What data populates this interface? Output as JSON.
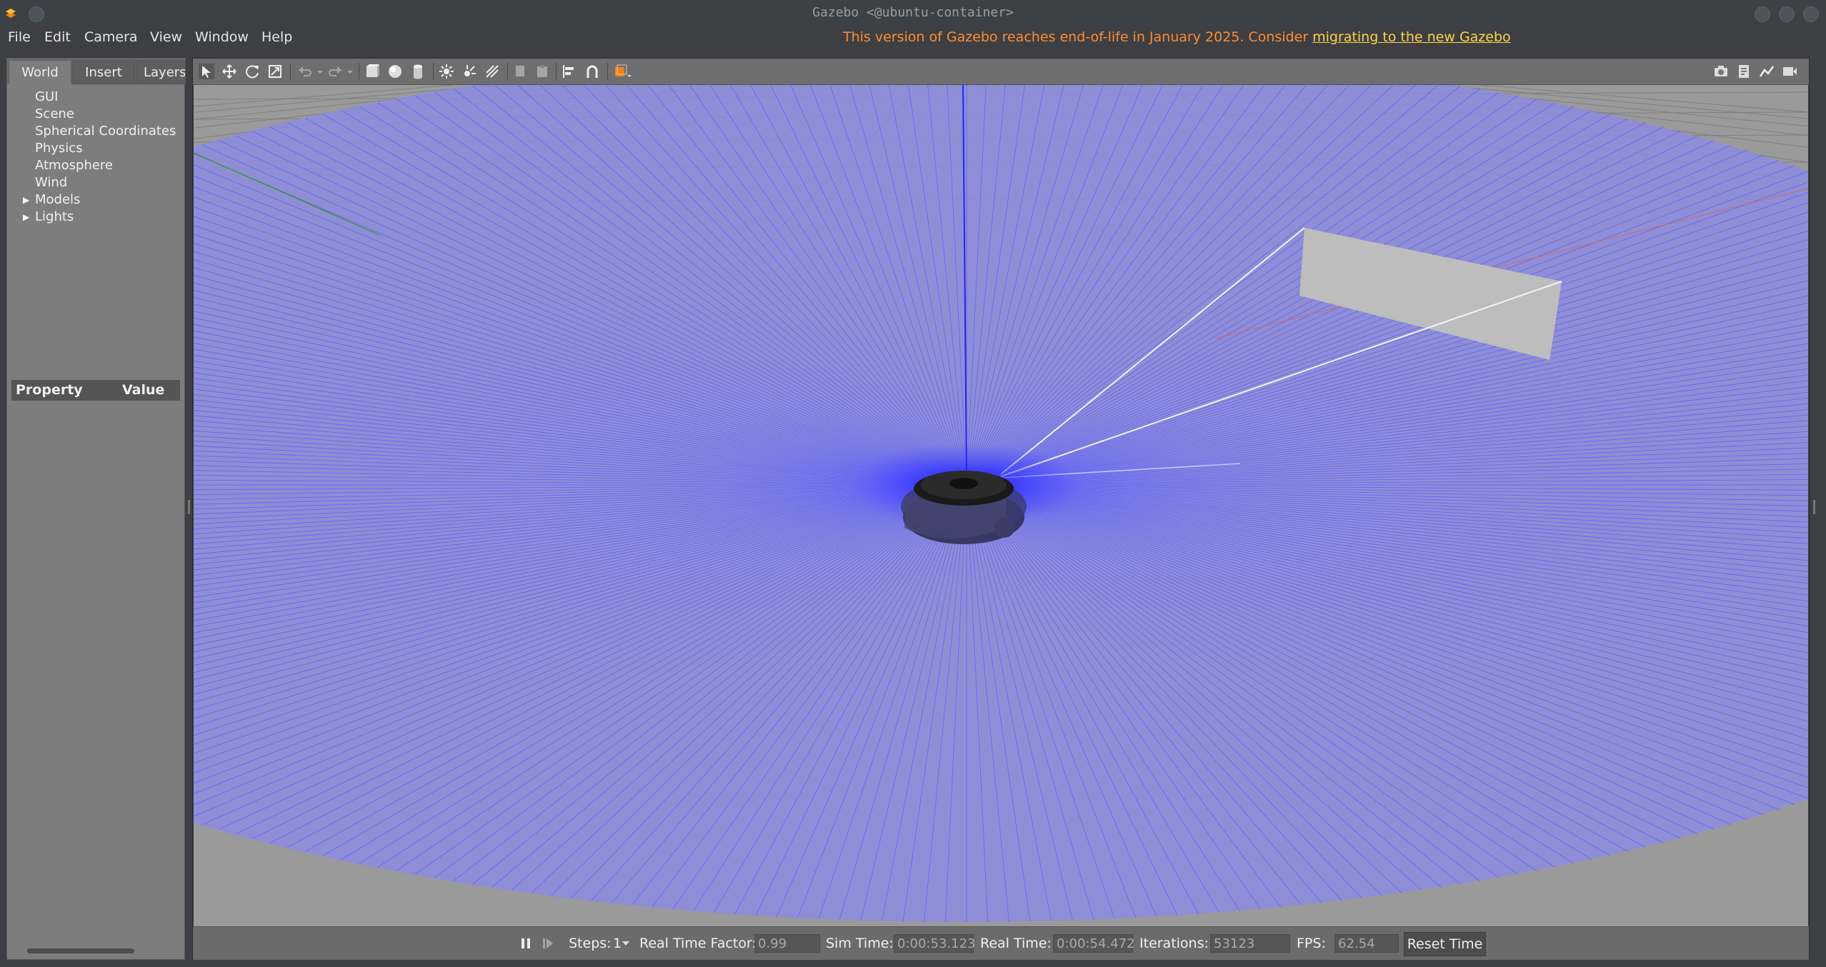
{
  "window": {
    "title": "Gazebo <@ubuntu-container>"
  },
  "menu": {
    "items": [
      {
        "label": "File"
      },
      {
        "label": "Edit"
      },
      {
        "label": "Camera"
      },
      {
        "label": "View"
      },
      {
        "label": "Window"
      },
      {
        "label": "Help"
      }
    ],
    "notice": {
      "text": "This version of Gazebo reaches end-of-life in January 2025. Consider ",
      "link": "migrating to the new Gazebo",
      "color": "#ff8c35",
      "link_color": "#ffd24a"
    }
  },
  "left_panel": {
    "tabs": [
      {
        "label": "World"
      },
      {
        "label": "Insert"
      },
      {
        "label": "Layers"
      }
    ],
    "tree": [
      {
        "label": "GUI"
      },
      {
        "label": "Scene"
      },
      {
        "label": "Spherical Coordinates"
      },
      {
        "label": "Physics"
      },
      {
        "label": "Atmosphere"
      },
      {
        "label": "Wind"
      },
      {
        "label": "Models",
        "expandable": true
      },
      {
        "label": "Lights",
        "expandable": true
      }
    ],
    "property_header": {
      "property": "Property",
      "value": "Value"
    }
  },
  "toolbar": {
    "left_icons": [
      "select-arrow-icon",
      "translate-icon",
      "rotate-icon",
      "scale-icon",
      "undo-icon",
      "undo-history-icon",
      "redo-icon",
      "redo-history-icon",
      "box-icon",
      "sphere-icon",
      "cylinder-icon",
      "point-light-icon",
      "spot-light-icon",
      "directional-light-icon",
      "copy-icon",
      "paste-icon",
      "align-icon",
      "snap-icon",
      "view-angle-icon"
    ],
    "right_icons": [
      "screenshot-icon",
      "log-icon",
      "plot-icon",
      "video-record-icon"
    ]
  },
  "status": {
    "steps_label": "Steps:",
    "steps_value": "1",
    "rtf_label": "Real Time Factor:",
    "rtf_value": "0.99",
    "sim_time_label": "Sim Time:",
    "sim_time_value": "0:00:53.123",
    "real_time_label": "Real Time:",
    "real_time_value": "0:00:54.472",
    "iterations_label": "Iterations:",
    "iterations_value": "53123",
    "fps_label": "FPS:",
    "fps_value": "62.54",
    "reset_label": "Reset Time"
  },
  "colors": {
    "laser": "#5a5aff",
    "ground": "#8e8e8e",
    "background": "#3d3f42"
  }
}
